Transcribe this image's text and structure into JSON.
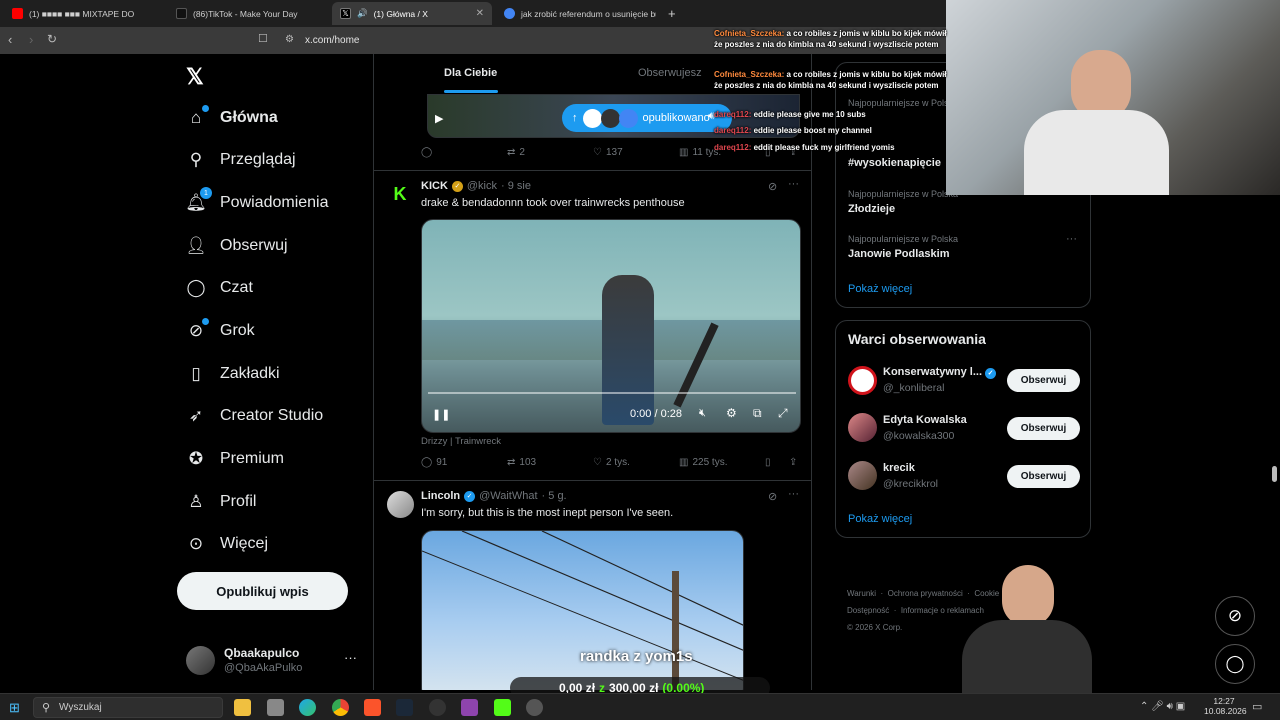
{
  "browser": {
    "tabs": [
      {
        "label": "(1) ■■■■ ■■■ MIXTAPE DO",
        "color": "#ff0000"
      },
      {
        "label": "(86)TikTok - Make Your Day",
        "color": "#111111"
      },
      {
        "label": "(1) Główna / X",
        "color": "#000000"
      },
      {
        "label": "jak zrobić referendum o usunięcie bu",
        "color": "#4285f4"
      }
    ],
    "url": "x.com/home"
  },
  "nav": {
    "items": [
      {
        "label": "Główna",
        "icon": "home-icon"
      },
      {
        "label": "Przeglądaj",
        "icon": "search-icon"
      },
      {
        "label": "Powiadomienia",
        "icon": "bell-icon",
        "badge": "1"
      },
      {
        "label": "Obserwuj",
        "icon": "person-plus-icon"
      },
      {
        "label": "Czat",
        "icon": "chat-icon"
      },
      {
        "label": "Grok",
        "icon": "grok-icon"
      },
      {
        "label": "Zakładki",
        "icon": "bookmark-icon"
      },
      {
        "label": "Creator Studio",
        "icon": "rocket-icon"
      },
      {
        "label": "Premium",
        "icon": "premium-icon"
      },
      {
        "label": "Profil",
        "icon": "profile-icon"
      },
      {
        "label": "Więcej",
        "icon": "more-icon"
      }
    ],
    "post_button": "Opublikuj wpis",
    "profile": {
      "name": "Qbaakapulco",
      "handle": "@QbaAkaPulko"
    }
  },
  "feed": {
    "tabs": [
      "Dla Ciebie",
      "Obserwujesz"
    ],
    "top_tweet": {
      "pill_label": "opublikowano",
      "actions": {
        "replies": "",
        "reposts": "2",
        "likes": "137",
        "views": "11 tys."
      }
    },
    "tweets": [
      {
        "name": "KICK",
        "handle": "@kick",
        "time": "· 9 sie",
        "text": "drake & bendadonnn took over trainwrecks penthouse",
        "video_time": "0:00 / 0:28",
        "caption": "Drizzy | Trainwreck",
        "actions": {
          "replies": "91",
          "reposts": "103",
          "likes": "2 tys.",
          "views": "225 tys."
        }
      },
      {
        "name": "Lincoln",
        "handle": "@WaitWhat",
        "time": "· 5 g.",
        "text": "I'm sorry, but this is the most inept person I've seen.",
        "overlay_title": "randka z yom1s",
        "overlay_money_a": "0,00 zł",
        "overlay_money_z": "z",
        "overlay_money_b": "300,00 zł",
        "overlay_pct": "(0.00%)"
      }
    ]
  },
  "sidebar": {
    "trends": [
      {
        "sub": "Najpopularniejsze w Polska",
        "title": "#wysokienapięcie"
      },
      {
        "sub": "Najpopularniejsze w Polska",
        "title": "Złodzieje"
      },
      {
        "sub": "Najpopularniejsze w Polska",
        "title": "Janowie Podlaskim"
      }
    ],
    "trends_more": "Pokaż więcej",
    "who_title": "Warci obserwowania",
    "who": [
      {
        "name": "Konserwatywny l...",
        "handle": "@_konliberal",
        "button": "Obserwuj"
      },
      {
        "name": "Edyta Kowalska",
        "handle": "@kowalska300",
        "button": "Obserwuj"
      },
      {
        "name": "krecik",
        "handle": "@krecikkrol",
        "button": "Obserwuj"
      }
    ],
    "who_more": "Pokaż więcej",
    "footer": [
      "Warunki",
      "Ochrona prywatności",
      "Cookie",
      "Dostępność",
      "Informacje o reklamach",
      "© 2026 X Corp."
    ]
  },
  "chat": [
    {
      "user": "Cofnieta_Szczeka:",
      "text": "a co robiles z jomis w kiblu bo kijek mówił że poszles z nia do kimbla na 40 sekund i wyszliscie potem"
    },
    {
      "user": "Cofnieta_Szczeka:",
      "text": "a co robiles z jomis w kiblu bo kijek mówił że poszles z nia do kimbla na 40 sekund i wyszliscie potem"
    },
    {
      "user": "dareq112:",
      "text": "eddie please give me 10 subs"
    },
    {
      "user": "dareq112:",
      "text": "eddie please boost my channel"
    },
    {
      "user": "dareq112:",
      "text": "eddit please fuck my girlfriend yomis"
    }
  ],
  "taskbar": {
    "search": "Wyszukaj",
    "time": "12:27",
    "date": "10.08.2026"
  }
}
